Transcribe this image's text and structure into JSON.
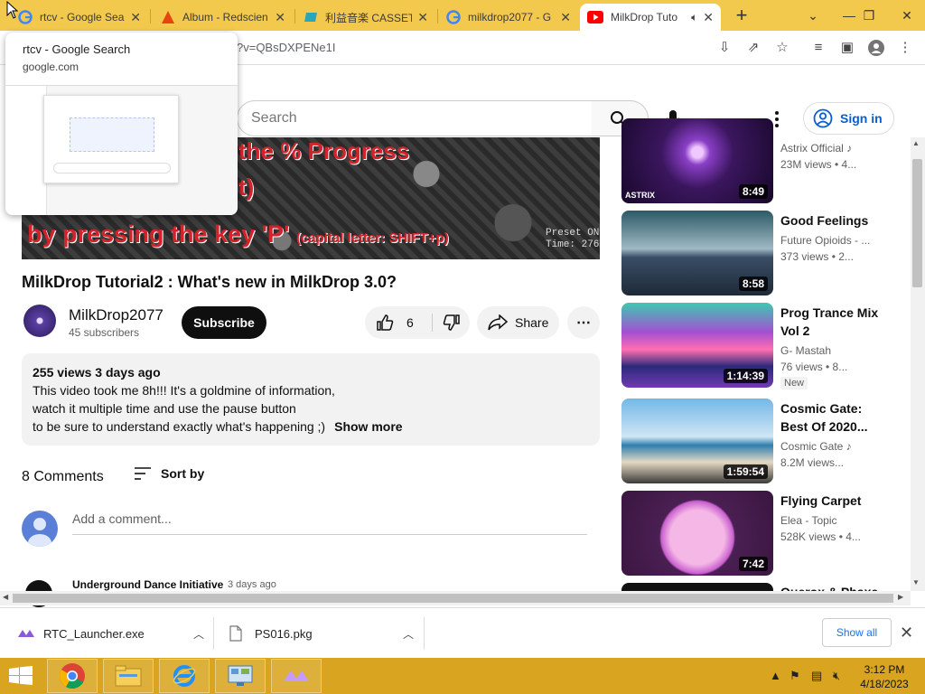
{
  "browser": {
    "tabs": [
      {
        "title": "rtcv - Google Sea",
        "icon": "google-icon",
        "active": false
      },
      {
        "title": "Album - Redscien",
        "icon": "warning-triangle-icon",
        "active": false
      },
      {
        "title": "利益音楽 CASSET",
        "icon": "cassette-icon",
        "active": false
      },
      {
        "title": "milkdrop2077 - G",
        "icon": "google-icon",
        "active": false
      },
      {
        "title": "MilkDrop Tuto",
        "icon": "youtube-icon",
        "active": true
      }
    ],
    "new_tab": "+",
    "url": "?v=QBsDXPENe1I",
    "tab_preview": {
      "title": "rtcv - Google Search",
      "domain": "google.com"
    }
  },
  "youtube": {
    "search_placeholder": "Search",
    "signin_label": "Sign in",
    "player": {
      "line1": "the % Progress",
      "line2": "t)",
      "line3": "by pressing the key 'P'",
      "line3_small": "(capital letter: SHIFT+p)",
      "preset_line1": "Preset ON",
      "preset_line2": "Time: 276"
    },
    "video": {
      "title": "MilkDrop Tutorial2 : What's new in MilkDrop 3.0?",
      "channel": "MilkDrop2077",
      "subscribers": "45 subscribers",
      "subscribe_label": "Subscribe",
      "likes": "6",
      "share_label": "Share"
    },
    "description": {
      "meta": "255 views  3 days ago",
      "line1": "This video took me 8h!!! It's a goldmine of information,",
      "line2": "watch it multiple time and use the pause button",
      "line3": "to be sure to understand exactly what's happening ;)",
      "show_more": "Show more"
    },
    "comments": {
      "count": "8 Comments",
      "sort_label": "Sort by",
      "add_placeholder": "Add a comment...",
      "first": {
        "author": "Underground Dance Initiative",
        "time": "3 days ago"
      }
    },
    "recommendations": [
      {
        "title": "",
        "channel": "Astrix Official ♪",
        "views": "23M views • 4...",
        "duration": "8:49"
      },
      {
        "title": "Good Feelings",
        "channel": "Future Opioids - ...",
        "views": "373 views • 2...",
        "duration": "8:58"
      },
      {
        "title": "Prog Trance Mix Vol 2",
        "channel": "G- Mastah",
        "views": "76 views • 8...",
        "duration": "1:14:39",
        "badge": "New"
      },
      {
        "title": "Cosmic Gate: Best Of 2020...",
        "channel": "Cosmic Gate ♪",
        "views": "8.2M views...",
        "duration": "1:59:54"
      },
      {
        "title": "Flying Carpet",
        "channel": "Elea - Topic",
        "views": "528K views • 4...",
        "duration": "7:42"
      },
      {
        "title": "Querox & Phaxe",
        "channel": "",
        "views": "",
        "duration": ""
      }
    ]
  },
  "downloads": {
    "items": [
      {
        "name": "RTC_Launcher.exe",
        "icon": "launcher-icon"
      },
      {
        "name": "PS016.pkg",
        "icon": "file-icon"
      }
    ],
    "show_all": "Show all"
  },
  "taskbar": {
    "time": "3:12 PM",
    "date": "4/18/2023"
  },
  "colors": {
    "tab_strip": "#f2c94c",
    "taskbar": "#d9a520",
    "youtube_red": "#ff0000",
    "link_blue": "#065fd4"
  }
}
